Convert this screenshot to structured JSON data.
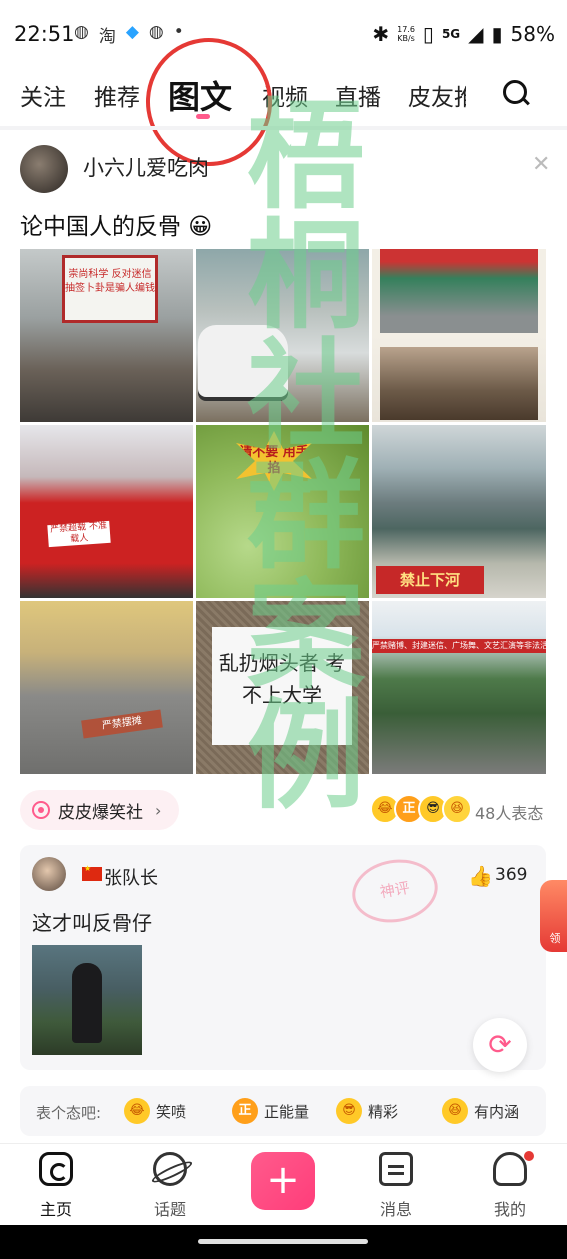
{
  "status_bar": {
    "time": "22:51",
    "app_icons": [
      "wechat-icon",
      "taobao-icon",
      "qq-icon",
      "wechat-icon",
      "dot-icon"
    ],
    "speed_value": "17.6",
    "speed_unit": "KB/s",
    "network": "5G",
    "battery": "58%"
  },
  "top_tabs": [
    {
      "label": "关注"
    },
    {
      "label": "推荐"
    },
    {
      "label": "图文",
      "active": true
    },
    {
      "label": "视频"
    },
    {
      "label": "直播"
    },
    {
      "label": "皮友推"
    }
  ],
  "post": {
    "author": "小六儿爱吃肉",
    "title": "论中国人的反骨 😀",
    "images": [
      {
        "sign_text": "崇尚科学 反对迷信 抽签卜卦是骗人编钱"
      },
      {
        "caption": ""
      },
      {
        "caption": ""
      },
      {
        "label_text": "严禁超载 不准载人"
      },
      {
        "star_text": "请不要 用手掐"
      },
      {
        "warning_text": "禁止下河"
      },
      {
        "board_text": "严禁摆摊"
      },
      {
        "paper_text": "乱扔烟头者 考不上大学"
      },
      {
        "banner_text": "严禁赌博、封建迷信、广场舞、文艺汇演等非法活动示范点"
      }
    ],
    "community": "皮皮爆笑社",
    "reaction_count": "48人表态"
  },
  "hot_comment": {
    "user": "张队长",
    "likes": "369",
    "text": "这才叫反骨仔",
    "stamp": "神评"
  },
  "quick_reactions": {
    "label": "表个态吧:",
    "items": [
      {
        "label": "笑喷",
        "face": "😂"
      },
      {
        "label": "正能量",
        "face": "正"
      },
      {
        "label": "精彩",
        "face": "😎"
      },
      {
        "label": "有内涵",
        "face": "😆"
      }
    ]
  },
  "side_badge": "领",
  "bottom_nav": [
    {
      "label": "主页",
      "active": true
    },
    {
      "label": "话题"
    },
    {
      "label": "消息"
    },
    {
      "label": "我的"
    }
  ],
  "watermark": "梧桐社群案例",
  "accent_color": "#ff5b8c"
}
